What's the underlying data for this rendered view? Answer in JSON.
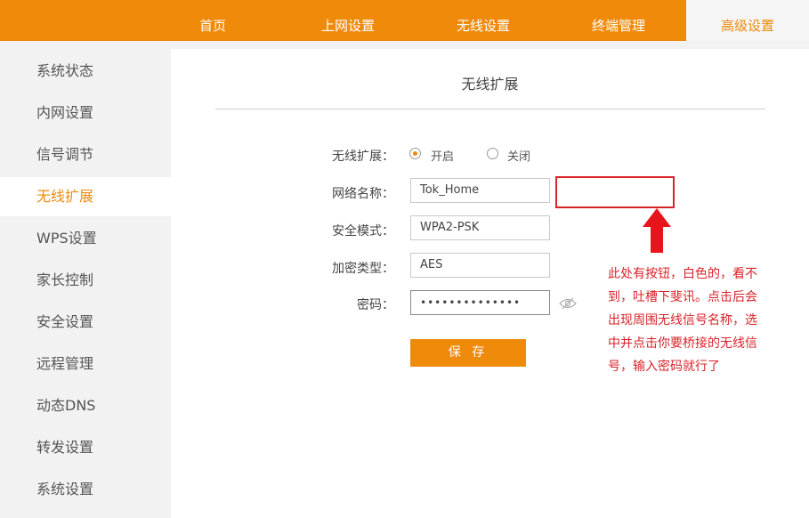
{
  "nav": {
    "items": [
      {
        "label": "首页"
      },
      {
        "label": "上网设置"
      },
      {
        "label": "无线设置"
      },
      {
        "label": "终端管理"
      },
      {
        "label": "高级设置"
      }
    ],
    "accent_color": "#f08a0b"
  },
  "sidebar": {
    "items": [
      {
        "label": "系统状态"
      },
      {
        "label": "内网设置"
      },
      {
        "label": "信号调节"
      },
      {
        "label": "无线扩展"
      },
      {
        "label": "WPS设置"
      },
      {
        "label": "家长控制"
      },
      {
        "label": "安全设置"
      },
      {
        "label": "远程管理"
      },
      {
        "label": "动态DNS"
      },
      {
        "label": "转发设置"
      },
      {
        "label": "系统设置"
      }
    ],
    "active_item": "无线扩展"
  },
  "main": {
    "title": "无线扩展",
    "form": {
      "extend_label": "无线扩展：",
      "radio_on": "开启",
      "radio_off": "关闭",
      "selected": "开启",
      "ssid_label": "网络名称：",
      "ssid_value": "Tok_Home",
      "security_label": "安全模式：",
      "security_value": "WPA2-PSK",
      "encryption_label": "加密类型：",
      "encryption_value": "AES",
      "password_label": "密码：",
      "password_value": "••••••••••••••",
      "save_label": "保 存"
    },
    "annotation": {
      "text": "此处有按钮，白色的，看不到，吐槽下斐讯。点击后会出现周围无线信号名称，选中并点击你要桥接的无线信号，输入密码就行了",
      "color": "#d9232a"
    }
  }
}
